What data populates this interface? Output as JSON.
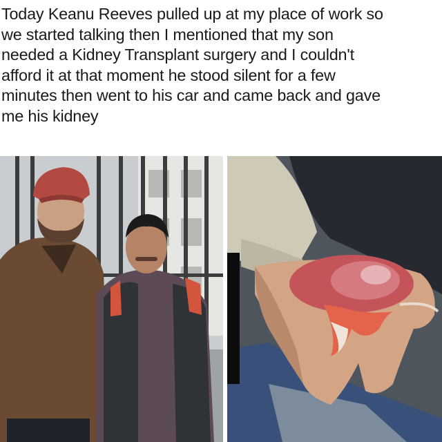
{
  "post": {
    "caption_lines": [
      "Today Keanu Reeves pulled up at my place of work so",
      "we started talking then I mentioned that my son",
      "needed a Kidney Transplant surgery and I couldn't",
      "afford it at that moment he stood silent for a few",
      "minutes then went to his car and came back and gave",
      "me his kidney"
    ]
  },
  "images": {
    "left": {
      "icon": "photo-two-men-icon"
    },
    "right": {
      "icon": "photo-kidney-in-hand-icon"
    }
  }
}
